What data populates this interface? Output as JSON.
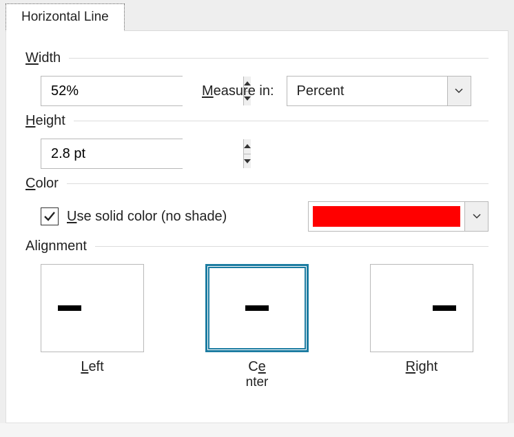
{
  "tab": {
    "label": "Horizontal Line"
  },
  "width": {
    "label": "Width",
    "accel": "W",
    "value": "52%",
    "measureLabel": "Measure in:",
    "measureAccel": "M",
    "measureValue": "Percent"
  },
  "height": {
    "label": "Height",
    "accel": "H",
    "value": "2.8 pt"
  },
  "color": {
    "label": "Color",
    "accel": "C",
    "checkboxLabel": "Use solid color (no shade)",
    "checkboxAccel": "U",
    "checked": true,
    "value": "#ff0000"
  },
  "alignment": {
    "label": "Alignment",
    "options": [
      {
        "label": "Left",
        "accel": "L",
        "selected": false
      },
      {
        "label": "Center",
        "accel": "e",
        "selected": true
      },
      {
        "label": "Right",
        "accel": "R",
        "selected": false
      }
    ]
  }
}
